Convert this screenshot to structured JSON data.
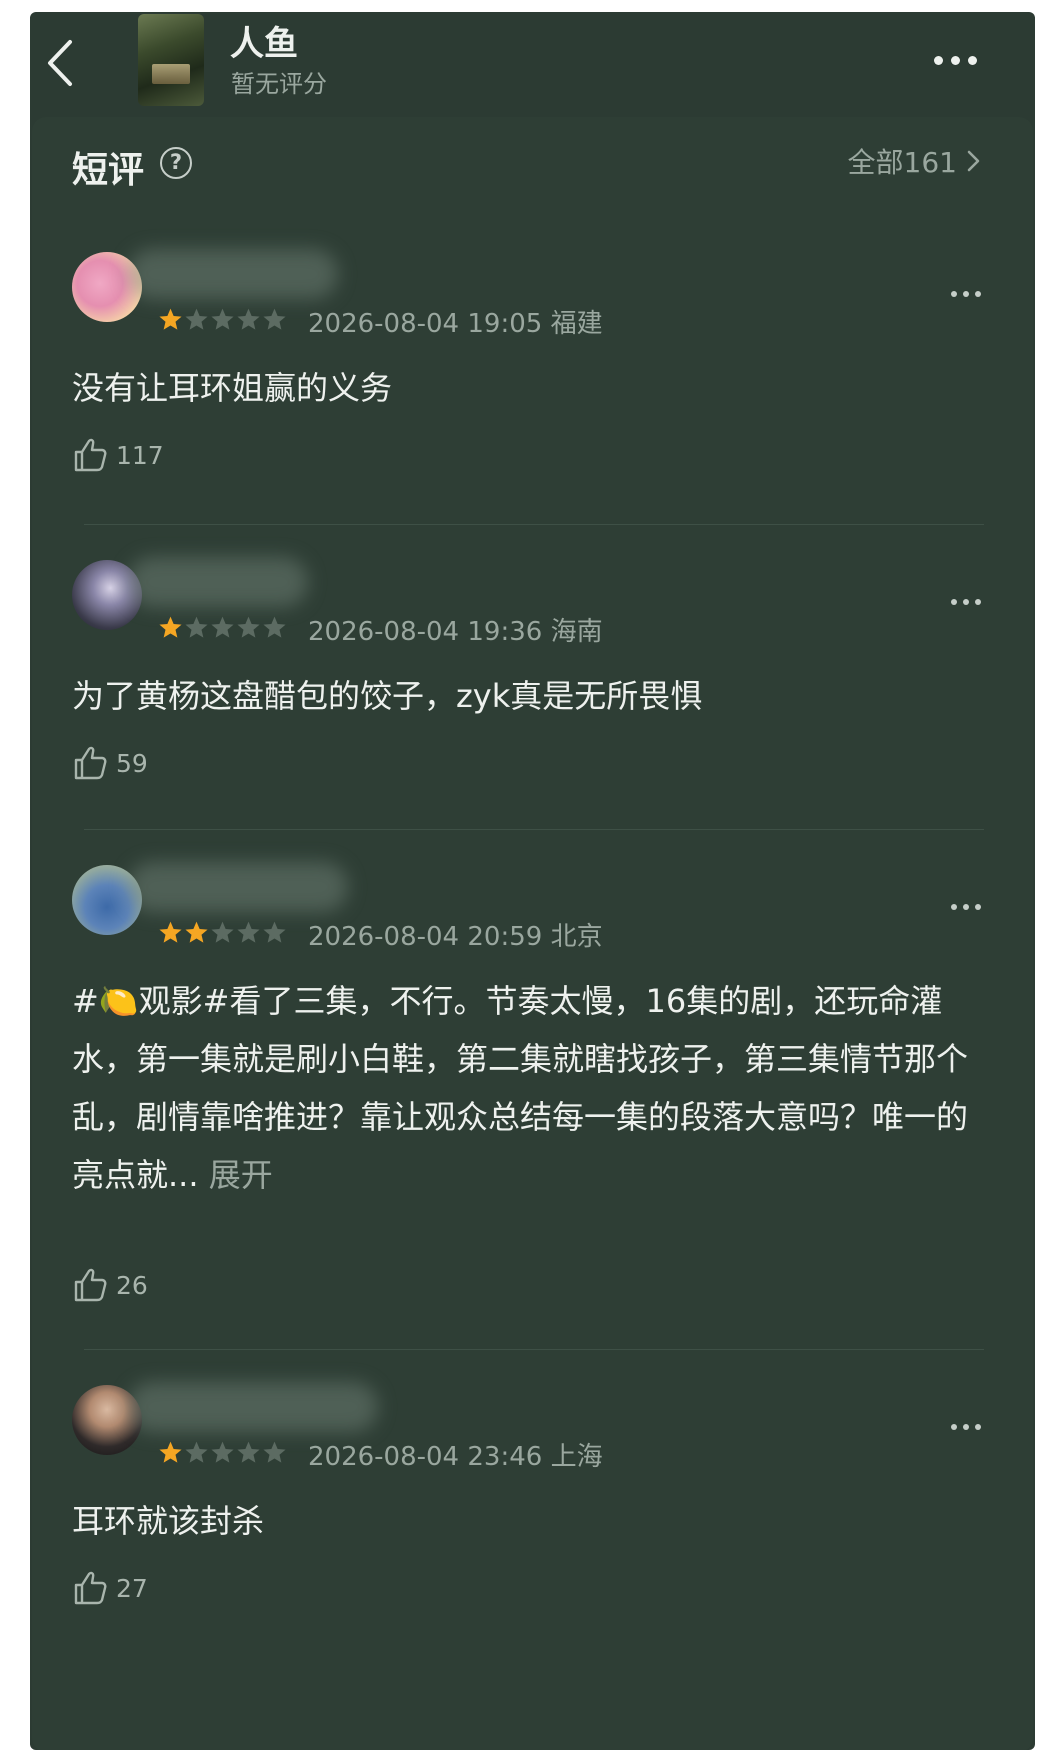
{
  "header": {
    "movie_title": "人鱼",
    "movie_score": "暂无评分"
  },
  "section": {
    "title": "短评",
    "all_link": "全部161"
  },
  "colors": {
    "background": "#2c3b33",
    "card": "#2e3e35",
    "star_on": "#f5a623",
    "star_off": "#5c6b62",
    "text_primary": "#eef1ee",
    "text_secondary": "#9aa79f"
  },
  "reviews": [
    {
      "rating": 1,
      "datetime": "2026-08-04 19:05",
      "location": "福建",
      "content": "没有让耳环姐赢的义务",
      "likes": "117"
    },
    {
      "rating": 1,
      "datetime": "2026-08-04 19:36",
      "location": "海南",
      "content": "为了黄杨这盘醋包的饺子，zyk真是无所畏惧",
      "likes": "59"
    },
    {
      "rating": 2,
      "datetime": "2026-08-04 20:59",
      "location": "北京",
      "content": "#🍋观影#看了三集，不行。节奏太慢，16集的剧，还玩命灌水，第一集就是刷小白鞋，第二集就瞎找孩子，第三集情节那个乱，剧情靠啥推进？靠让观众总结每一集的段落大意吗？唯一的亮点就...",
      "expand": "展开",
      "likes": "26"
    },
    {
      "rating": 1,
      "datetime": "2026-08-04 23:46",
      "location": "上海",
      "content": "耳环就该封杀",
      "likes": "27"
    }
  ]
}
